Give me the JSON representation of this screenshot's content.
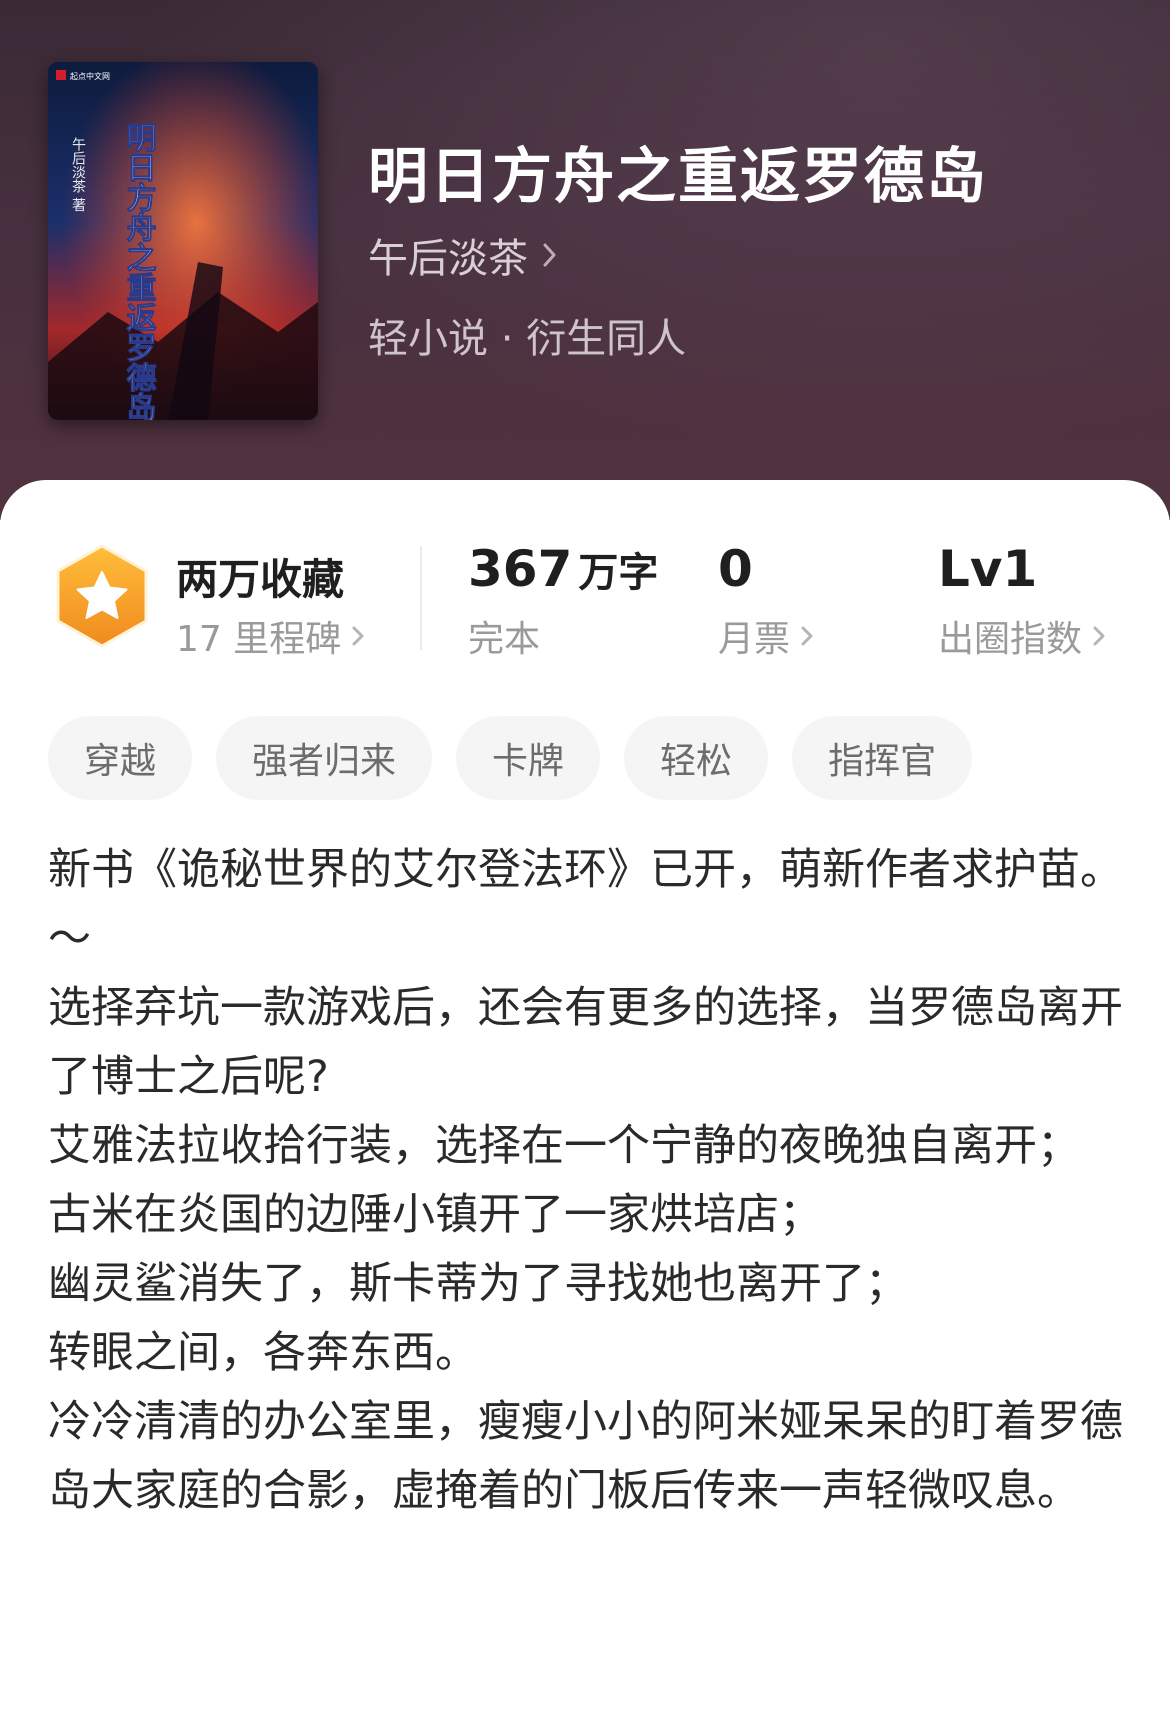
{
  "book": {
    "title": "明日方舟之重返罗德岛",
    "author": "午后淡茶",
    "genre": "轻小说 · 衍生同人",
    "cover": {
      "publisher_mark": "起点中文网",
      "author_text": "午后淡茶 著",
      "title_text": "明日方舟之重返罗德岛"
    }
  },
  "stats": {
    "collection": {
      "title": "两万收藏",
      "sub": "17 里程碑"
    },
    "words": {
      "value": "367",
      "unit": "万字",
      "sub": "完本"
    },
    "tickets": {
      "value": "0",
      "sub": "月票"
    },
    "level": {
      "value": "Lv1",
      "sub": "出圈指数"
    }
  },
  "tags": [
    "穿越",
    "强者归来",
    "卡牌",
    "轻松",
    "指挥官"
  ],
  "description": [
    "新书《诡秘世界的艾尔登法环》已开，萌新作者求护苗。",
    "～",
    "选择弃坑一款游戏后，还会有更多的选择，当罗德岛离开了博士之后呢?",
    "艾雅法拉收拾行装，选择在一个宁静的夜晚独自离开；",
    "古米在炎国的边陲小镇开了一家烘培店；",
    "幽灵鲨消失了，斯卡蒂为了寻找她也离开了；",
    "转眼之间，各奔东西。",
    "冷冷清清的办公室里，瘦瘦小小的阿米娅呆呆的盯着罗德岛大家庭的合影，虚掩着的门板后传来一声轻微叹息。"
  ],
  "colors": {
    "header_bg": "#47303f",
    "badge_orange": "#f5a623",
    "text_dark": "#1f1f1f",
    "text_muted": "#9a9a9a",
    "tag_bg": "#f5f5f5"
  },
  "icons": {
    "badge": "star-hexagon-icon",
    "chevron": "chevron-right-icon"
  }
}
